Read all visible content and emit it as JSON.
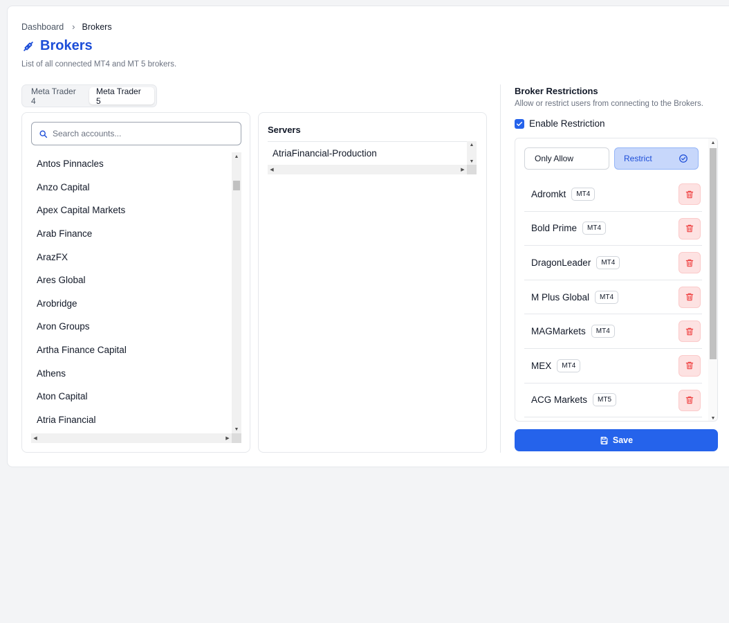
{
  "breadcrumb": {
    "home": "Dashboard",
    "separator": "›",
    "current": "Brokers"
  },
  "header": {
    "title": "Brokers",
    "subtitle": "List of all connected MT4 and MT 5 brokers.",
    "icon": "link-icon"
  },
  "tabs": [
    {
      "label": "Meta Trader 4",
      "active": false
    },
    {
      "label": "Meta Trader 5",
      "active": true
    }
  ],
  "accounts": {
    "search_placeholder": "Search accounts...",
    "search_value": "",
    "items": [
      "Antos Pinnacles",
      "Anzo Capital",
      "Apex Capital Markets",
      "Arab Finance",
      "ArazFX",
      "Ares Global",
      "Arobridge",
      "Aron Groups",
      "Artha Finance Capital",
      "Athens",
      "Aton Capital",
      "Atria Financial"
    ]
  },
  "servers": {
    "title": "Servers",
    "items": [
      "AtriaFinancial-Production"
    ]
  },
  "restrictions": {
    "title": "Broker Restrictions",
    "subtitle": "Allow or restrict users from connecting to the Brokers.",
    "enable_label": "Enable Restriction",
    "enabled": true,
    "mode_allow_label": "Only Allow",
    "mode_restrict_label": "Restrict",
    "selected_mode": "Restrict",
    "brokers": [
      {
        "name": "Adromkt",
        "platform": "MT4"
      },
      {
        "name": "Bold Prime",
        "platform": "MT4"
      },
      {
        "name": "DragonLeader",
        "platform": "MT4"
      },
      {
        "name": "M Plus Global",
        "platform": "MT4"
      },
      {
        "name": "MAGMarkets",
        "platform": "MT4"
      },
      {
        "name": "MEX",
        "platform": "MT4"
      },
      {
        "name": "ACG Markets",
        "platform": "MT5"
      }
    ]
  },
  "save_label": "Save",
  "colors": {
    "accent": "#2563eb",
    "title": "#1d4ed8",
    "danger": "#ef4444",
    "danger_bg": "#fde2e2",
    "restrict_bg": "#c7d7fb"
  }
}
